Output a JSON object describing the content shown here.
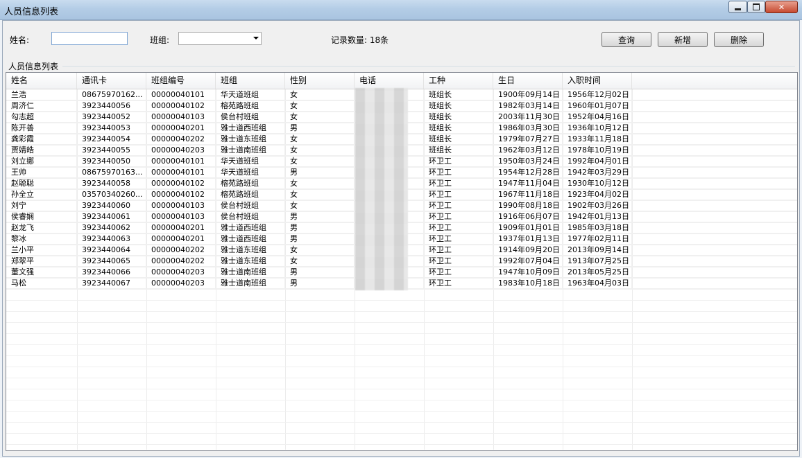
{
  "window": {
    "title": "人员信息列表"
  },
  "search": {
    "name_label": "姓名:",
    "name_value": "",
    "group_label": "班组:",
    "group_value": "",
    "record_count": "记录数量: 18条"
  },
  "toolbar": {
    "query_label": "查询",
    "add_label": "新增",
    "delete_label": "删除"
  },
  "group_box": {
    "label": "人员信息列表"
  },
  "table": {
    "columns": [
      "姓名",
      "通讯卡",
      "班组编号",
      "班组",
      "性别",
      "电话",
      "工种",
      "生日",
      "入职时间"
    ],
    "rows": [
      [
        "兰浩",
        "08675970162...",
        "00000040101",
        "华天道班组",
        "女",
        "",
        "班组长",
        "1900年09月14日",
        "1956年12月02日"
      ],
      [
        "周济仁",
        "3923440056",
        "00000040102",
        "榕苑路班组",
        "女",
        "",
        "班组长",
        "1982年03月14日",
        "1960年01月07日"
      ],
      [
        "勾志超",
        "3923440052",
        "00000040103",
        "侯台村班组",
        "女",
        "",
        "班组长",
        "2003年11月30日",
        "1952年04月16日"
      ],
      [
        "陈开善",
        "3923440053",
        "00000040201",
        "雅士道西班组",
        "男",
        "",
        "班组长",
        "1986年03月30日",
        "1936年10月12日"
      ],
      [
        "龚彩霞",
        "3923440054",
        "00000040202",
        "雅士道东班组",
        "女",
        "",
        "班组长",
        "1979年07月27日",
        "1933年11月18日"
      ],
      [
        "贾婧皓",
        "3923440055",
        "00000040203",
        "雅士道南班组",
        "女",
        "",
        "班组长",
        "1962年03月12日",
        "1978年10月19日"
      ],
      [
        "刘立娜",
        "3923440050",
        "00000040101",
        "华天道班组",
        "女",
        "",
        "环卫工",
        "1950年03月24日",
        "1992年04月01日"
      ],
      [
        "王帅",
        "08675970163...",
        "00000040101",
        "华天道班组",
        "男",
        "",
        "环卫工",
        "1954年12月28日",
        "1942年03月29日"
      ],
      [
        "赵聪聪",
        "3923440058",
        "00000040102",
        "榕苑路班组",
        "女",
        "",
        "环卫工",
        "1947年11月04日",
        "1930年10月12日"
      ],
      [
        "孙全立",
        "03570340260...",
        "00000040102",
        "榕苑路班组",
        "女",
        "",
        "环卫工",
        "1967年11月18日",
        "1923年04月02日"
      ],
      [
        "刘宁",
        "3923440060",
        "00000040103",
        "侯台村班组",
        "女",
        "",
        "环卫工",
        "1990年08月18日",
        "1902年03月26日"
      ],
      [
        "侯睿娴",
        "3923440061",
        "00000040103",
        "侯台村班组",
        "男",
        "",
        "环卫工",
        "1916年06月07日",
        "1942年01月13日"
      ],
      [
        "赵龙飞",
        "3923440062",
        "00000040201",
        "雅士道西班组",
        "男",
        "",
        "环卫工",
        "1909年01月01日",
        "1985年03月18日"
      ],
      [
        "黎冰",
        "3923440063",
        "00000040201",
        "雅士道西班组",
        "男",
        "",
        "环卫工",
        "1937年01月13日",
        "1977年02月11日"
      ],
      [
        "兰小平",
        "3923440064",
        "00000040202",
        "雅士道东班组",
        "女",
        "",
        "环卫工",
        "1914年09月20日",
        "2013年09月14日"
      ],
      [
        "郑翠平",
        "3923440065",
        "00000040202",
        "雅士道东班组",
        "女",
        "",
        "环卫工",
        "1992年07月04日",
        "1913年07月25日"
      ],
      [
        "董文强",
        "3923440066",
        "00000040203",
        "雅士道南班组",
        "男",
        "",
        "环卫工",
        "1947年10月09日",
        "2013年05月25日"
      ],
      [
        "马松",
        "3923440067",
        "00000040203",
        "雅士道南班组",
        "男",
        "",
        "环卫工",
        "1983年10月18日",
        "1963年04月03日"
      ]
    ]
  }
}
